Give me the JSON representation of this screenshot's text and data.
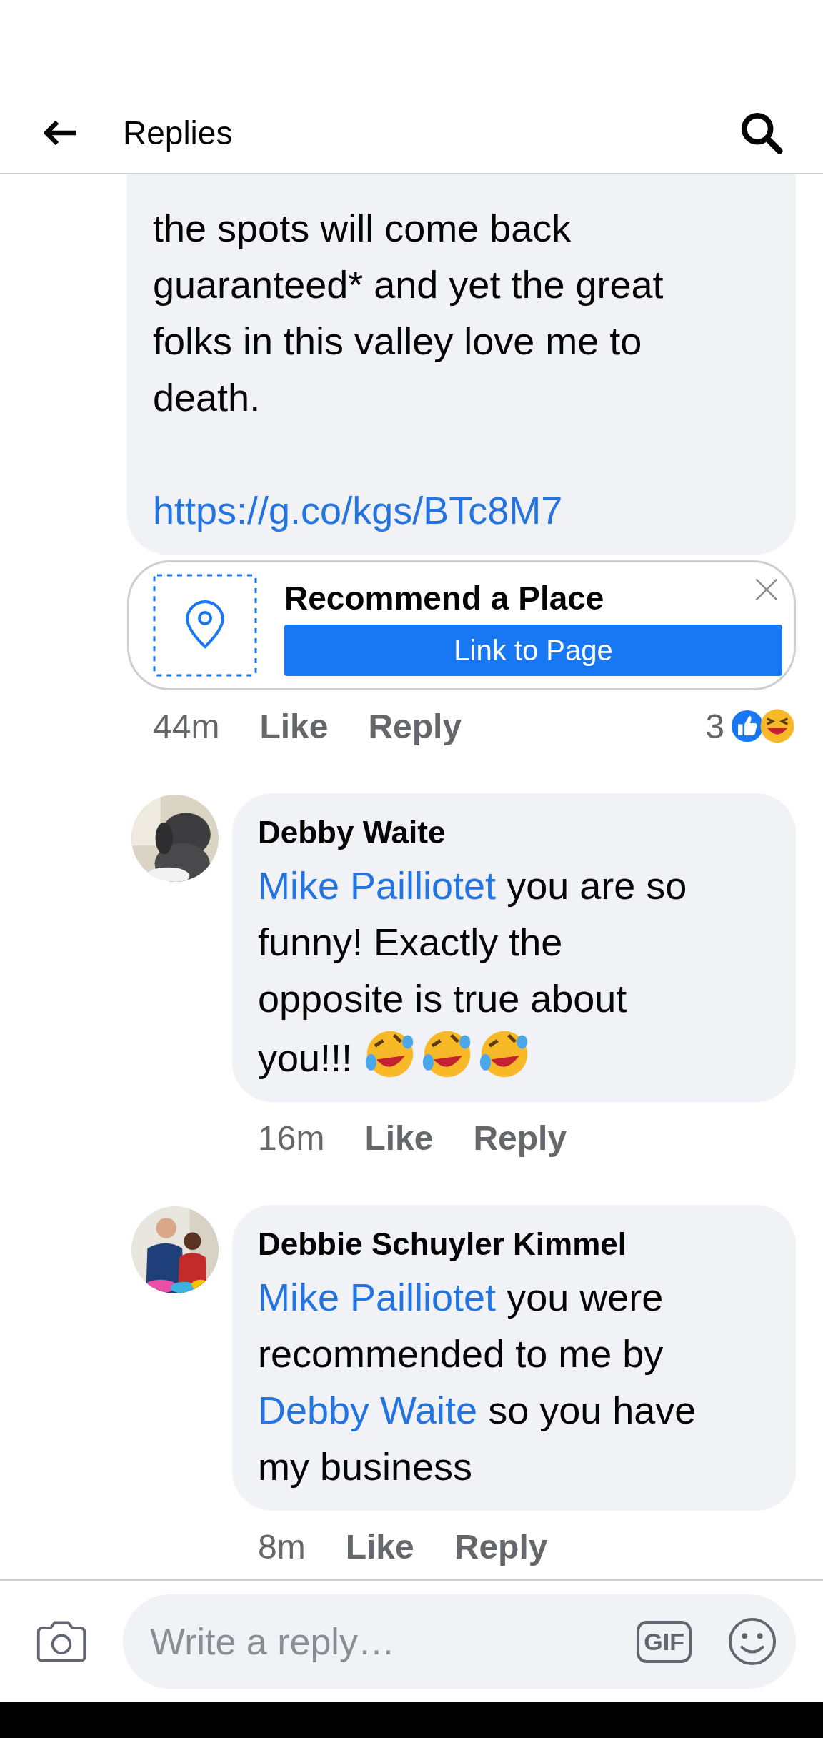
{
  "header": {
    "title": "Replies"
  },
  "comments": [
    {
      "segments": [
        {
          "kind": "text",
          "text": "the spots will come back\nguaranteed* and yet the great\nfolks in this valley love me to\ndeath."
        }
      ],
      "link": "https://g.co/kgs/BTc8M7",
      "attachment": {
        "title": "Recommend a Place",
        "button": "Link to Page"
      },
      "time": "44m",
      "like": "Like",
      "reply": "Reply",
      "reaction_count": "3"
    },
    {
      "avatar": {
        "kind": "picture"
      },
      "author": "Debby Waite",
      "segments": [
        {
          "kind": "mention",
          "text": "Mike Pailliotet"
        },
        {
          "kind": "text",
          "text": " you are so\nfunny! Exactly the\nopposite is true about\nyou!!! "
        },
        {
          "kind": "emoji"
        },
        {
          "kind": "emoji"
        },
        {
          "kind": "emoji"
        }
      ],
      "time": "16m",
      "like": "Like",
      "reply": "Reply"
    },
    {
      "avatar": {
        "kind": "picture"
      },
      "author": "Debbie Schuyler Kimmel",
      "segments": [
        {
          "kind": "mention",
          "text": "Mike Pailliotet"
        },
        {
          "kind": "text",
          "text": " you were\nrecommended to me by\n"
        },
        {
          "kind": "mention",
          "text": "Debby Waite"
        },
        {
          "kind": "text",
          "text": " so you have\nmy business"
        }
      ],
      "time": "8m",
      "like": "Like",
      "reply": "Reply"
    }
  ],
  "composer": {
    "placeholder": "Write a reply…",
    "gif": "GIF"
  }
}
